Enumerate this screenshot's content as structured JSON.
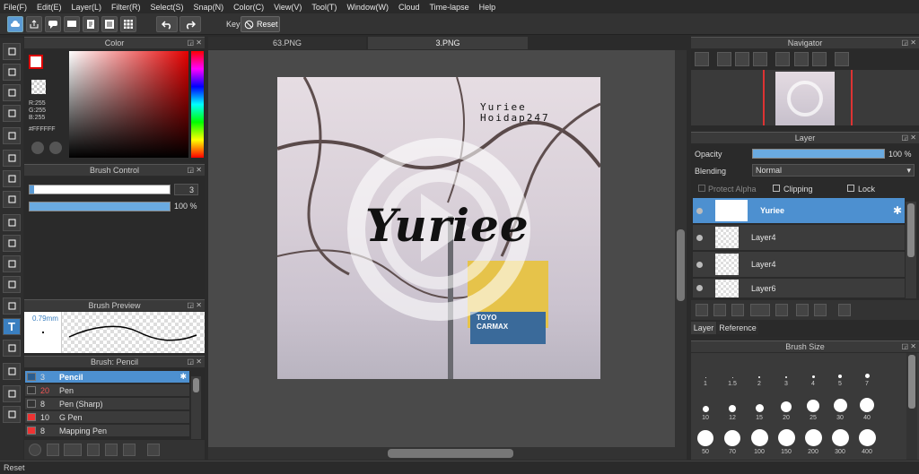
{
  "menu": [
    "File(F)",
    "Edit(E)",
    "Layer(L)",
    "Filter(R)",
    "Select(S)",
    "Snap(N)",
    "Color(C)",
    "View(V)",
    "Tool(T)",
    "Window(W)",
    "Cloud",
    "Time-lapse",
    "Help"
  ],
  "toolbar": {
    "key_label": "Key",
    "reset_label": "Reset"
  },
  "color_panel": {
    "title": "Color",
    "r": "R:255",
    "g": "G:255",
    "b": "B:255",
    "hex": "#FFFFFF"
  },
  "brush_control": {
    "title": "Brush Control",
    "size": "3",
    "opacity": "100 %"
  },
  "brush_preview": {
    "title": "Brush Preview",
    "size": "0.79mm"
  },
  "brush_list": {
    "title": "Brush: Pencil",
    "items": [
      {
        "num": "3",
        "name": "Pencil"
      },
      {
        "num": "20",
        "name": "Pen"
      },
      {
        "num": "8",
        "name": "Pen (Sharp)"
      },
      {
        "num": "10",
        "name": "G Pen"
      },
      {
        "num": "8",
        "name": "Mapping Pen"
      }
    ]
  },
  "tabs": [
    "63.PNG",
    "3.PNG"
  ],
  "canvas": {
    "line1": "Yuriee",
    "line2": "Hoidap247",
    "big_text": "Yuriee",
    "sign1": "TOYO",
    "sign2": "CARMAX"
  },
  "navigator": {
    "title": "Navigator"
  },
  "layer_panel": {
    "title": "Layer",
    "opacity_label": "Opacity",
    "opacity_value": "100 %",
    "blending_label": "Blending",
    "blending_value": "Normal",
    "protect_alpha": "Protect Alpha",
    "clipping": "Clipping",
    "lock": "Lock",
    "layers": [
      "Yuriee",
      "Layer4",
      "Layer4",
      "Layer6"
    ],
    "tab_layer": "Layer",
    "tab_reference": "Reference"
  },
  "brush_size": {
    "title": "Brush Size",
    "sizes": [
      "1",
      "1.5",
      "2",
      "3",
      "4",
      "5",
      "7",
      "10",
      "12",
      "15",
      "20",
      "25",
      "30",
      "40",
      "50",
      "70",
      "100",
      "150",
      "200",
      "300",
      "400"
    ]
  },
  "status": "Reset",
  "colors": {
    "accent": "#4d90d0",
    "panel": "#2b2b2b"
  }
}
